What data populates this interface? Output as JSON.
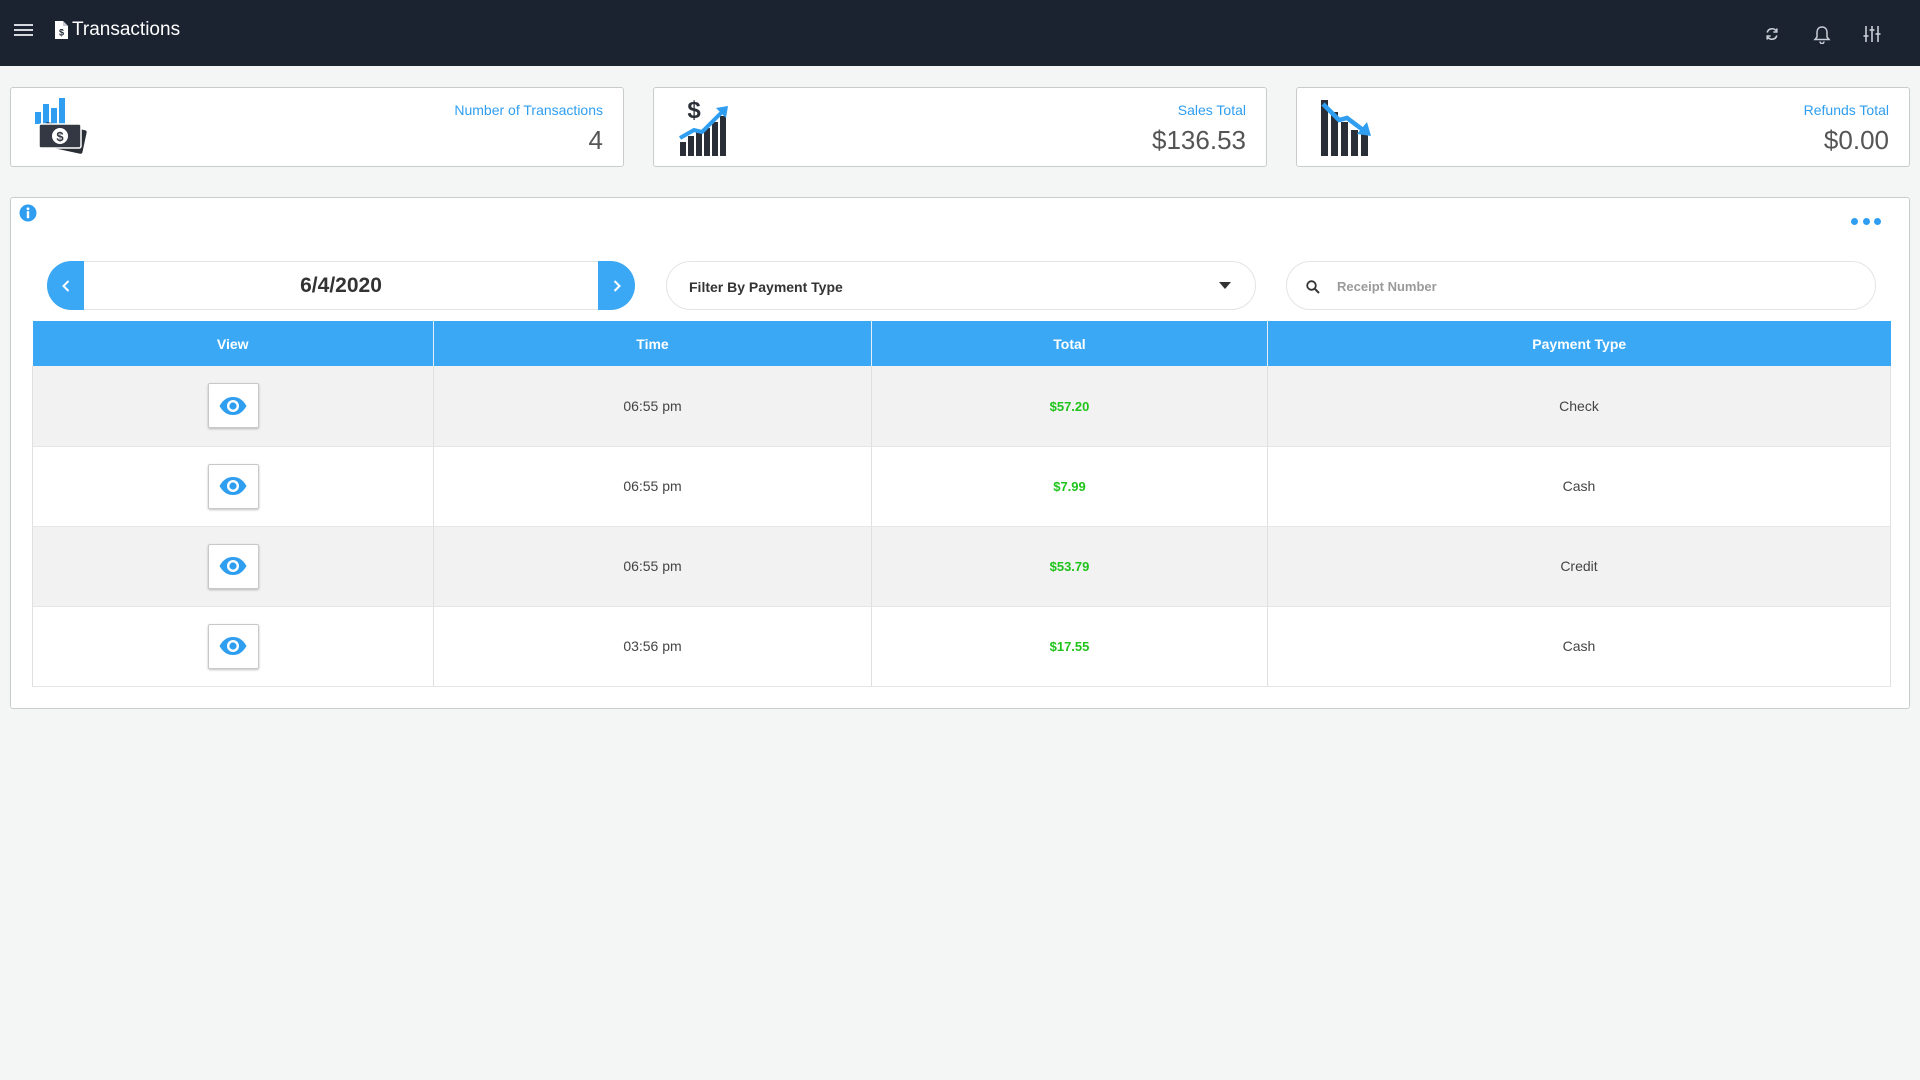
{
  "header": {
    "title": "Transactions",
    "icons": [
      "menu-icon",
      "document-dollar-icon",
      "refresh-icon",
      "bell-icon",
      "sliders-icon"
    ]
  },
  "stats": [
    {
      "label": "Number of Transactions",
      "value": "4",
      "icon": "transactions-chart-icon"
    },
    {
      "label": "Sales Total",
      "value": "$136.53",
      "icon": "sales-growth-icon"
    },
    {
      "label": "Refunds Total",
      "value": "$0.00",
      "icon": "refunds-decline-icon"
    }
  ],
  "controls": {
    "date": "6/4/2020",
    "filter_label": "Filter By Payment Type",
    "search_placeholder": "Receipt Number",
    "search_value": ""
  },
  "table": {
    "headers": [
      "View",
      "Time",
      "Total",
      "Payment Type"
    ],
    "rows": [
      {
        "time": "06:55 pm",
        "total": "$57.20",
        "payment_type": "Check"
      },
      {
        "time": "06:55 pm",
        "total": "$7.99",
        "payment_type": "Cash"
      },
      {
        "time": "06:55 pm",
        "total": "$53.79",
        "payment_type": "Credit"
      },
      {
        "time": "03:56 pm",
        "total": "$17.55",
        "payment_type": "Cash"
      }
    ]
  },
  "colors": {
    "topbar": "#1b2230",
    "accent": "#3aa8f5",
    "amount": "#1ec419"
  }
}
